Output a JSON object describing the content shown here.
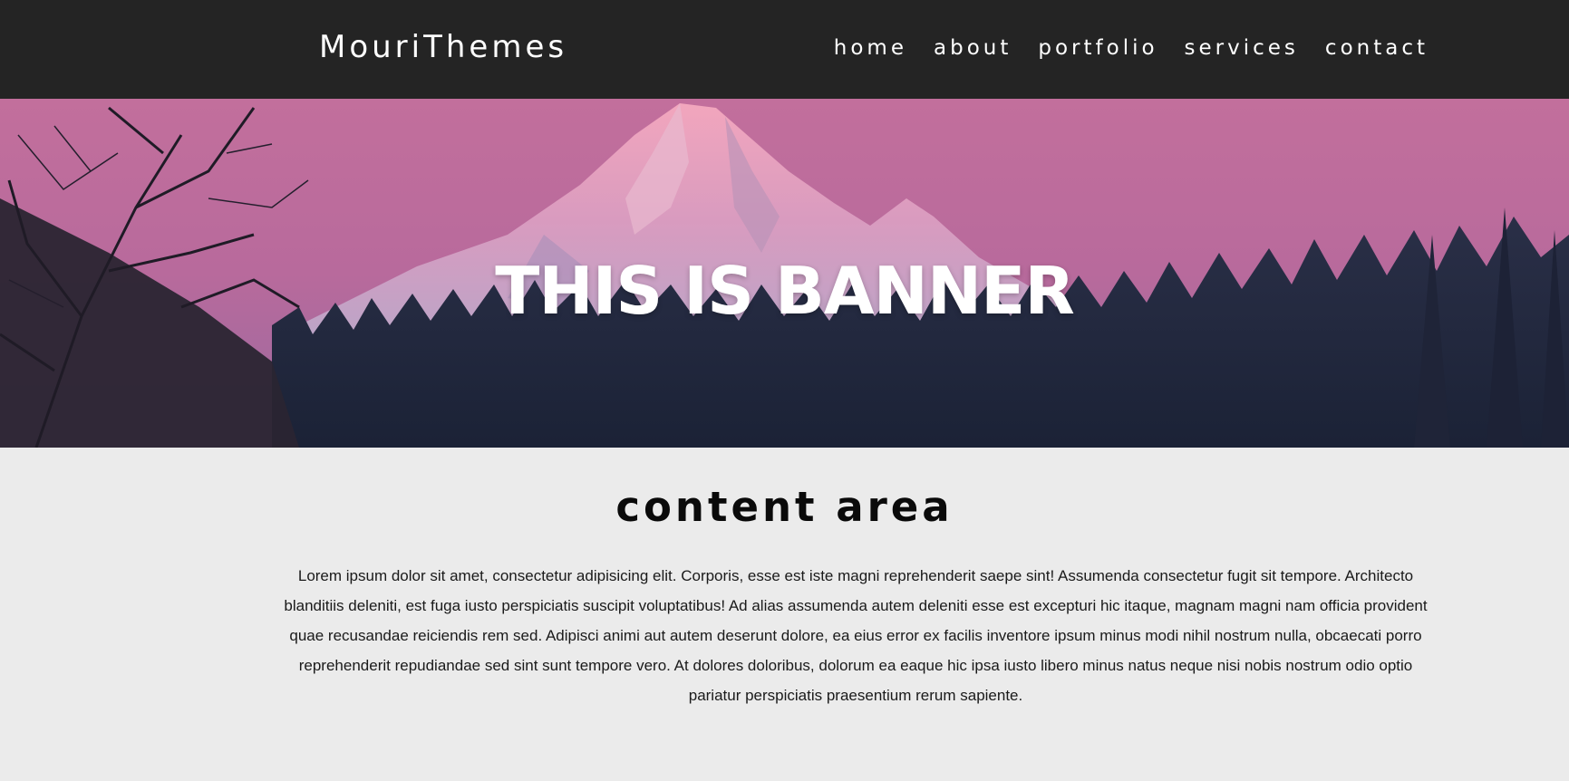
{
  "header": {
    "logo": "MouriThemes",
    "nav": [
      "home",
      "about",
      "portfolio",
      "services",
      "contact"
    ]
  },
  "banner": {
    "title": "THIS IS BANNER",
    "background_image": "pink-sky-mountain-with-forest"
  },
  "content": {
    "title": "content area",
    "body": "Lorem ipsum dolor sit amet, consectetur adipisicing elit. Corporis, esse est iste magni reprehenderit saepe sint! Assumenda consectetur fugit sit tempore. Architecto blanditiis deleniti, est fuga iusto perspiciatis suscipit voluptatibus! Ad alias assumenda autem deleniti esse est excepturi hic itaque, magnam magni nam officia provident quae recusandae reiciendis rem sed. Adipisci animi aut autem deserunt dolore, ea eius error ex facilis inventore ipsum minus modi nihil nostrum nulla, obcaecati porro reprehenderit repudiandae sed sint sunt tempore vero. At dolores doloribus, dolorum ea eaque hic ipsa iusto libero minus natus neque nisi nobis nostrum odio optio pariatur perspiciatis praesentium rerum sapiente."
  },
  "colors": {
    "header_bg": "#242424",
    "page_bg": "#ebebeb",
    "sky": "#c46f9b",
    "text_dark": "#0a0a0a"
  }
}
